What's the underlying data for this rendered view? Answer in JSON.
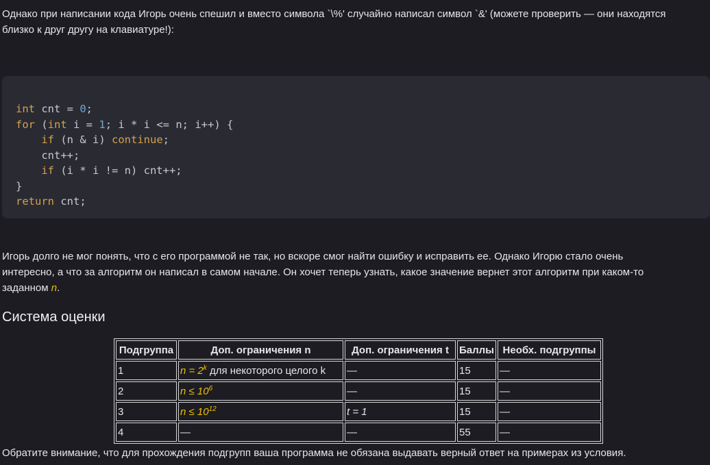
{
  "intro": {
    "line1": "Однако при написании кода Игорь очень спешил и вместо символа `\\%' случайно написал символ `&' (можете проверить — они находятся",
    "line2": "близко к друг другу на клавиатуре!):"
  },
  "code": {
    "l1_kw": "int",
    "l1_rest": " cnt = ",
    "l1_num": "0",
    "l1_end": ";",
    "l2_kw": "for",
    "l2_a": " (",
    "l2_kw2": "int",
    "l2_b": " i = ",
    "l2_num": "1",
    "l2_c": "; i * i <= n; i++) {",
    "l3_ind": "    ",
    "l3_kw": "if",
    "l3_a": " (n & i) ",
    "l3_kw2": "continue",
    "l3_b": ";",
    "l4": "    cnt++;",
    "l5_ind": "    ",
    "l5_kw": "if",
    "l5_a": " (i * i != n) cnt++;",
    "l6": "}",
    "l7_kw": "return",
    "l7_a": " cnt;"
  },
  "middle": {
    "line1": "Игорь долго не мог понять, что с его программой не так, но вскоре смог найти ошибку и исправить ее. Однако Игорю стало очень",
    "line2": "интересно, а что за алгоритм он написал в самом начале. Он хочет теперь узнать, какое значение вернет этот алгоритм при каком-то",
    "line3_pre": "заданном ",
    "line3_math": "n",
    "line3_post": "."
  },
  "section_title": "Система оценки",
  "table": {
    "headers": [
      "Подгруппа",
      "Доп. ограничения n",
      "Доп. ограничения t",
      "Баллы",
      "Необх. подгруппы"
    ],
    "rows": [
      {
        "group": "1",
        "n_math": "n = 2",
        "n_sup": "k",
        "n_text": " для некоторого целого k",
        "t": "—",
        "points": "15",
        "deps": "—"
      },
      {
        "group": "2",
        "n_math": "n ≤ 10",
        "n_sup": "6",
        "n_text": "",
        "t": "—",
        "points": "15",
        "deps": "—"
      },
      {
        "group": "3",
        "n_math": "n ≤ 10",
        "n_sup": "12",
        "n_text": "",
        "t": "t = 1",
        "points": "15",
        "deps": "—"
      },
      {
        "group": "4",
        "n_plain": "—",
        "t": "—",
        "points": "55",
        "deps": "—"
      }
    ]
  },
  "footer": "Обратите внимание, что для прохождения подгрупп ваша программа не обязана выдавать верный ответ на примерах из условия."
}
